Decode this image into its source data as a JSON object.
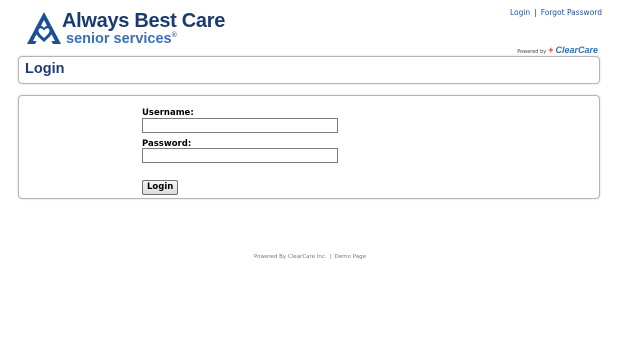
{
  "brand": {
    "name": "Always Best Care",
    "subtitle": "senior services",
    "registered_mark": "®",
    "color_primary": "#1c3a6e",
    "color_secondary": "#3b6fb6"
  },
  "top_nav": {
    "login": "Login",
    "separator": "|",
    "forgot_password": "Forgot Password"
  },
  "powered_badge": {
    "prefix": "Powered by",
    "plus": "+",
    "name": "ClearCare"
  },
  "page": {
    "title": "Login"
  },
  "form": {
    "username_label": "Username:",
    "username_value": "",
    "password_label": "Password:",
    "password_value": "",
    "submit_label": "Login"
  },
  "footer": {
    "powered_text": "Powered By ClearCare Inc.",
    "separator": "|",
    "demo_link": "Demo Page"
  }
}
